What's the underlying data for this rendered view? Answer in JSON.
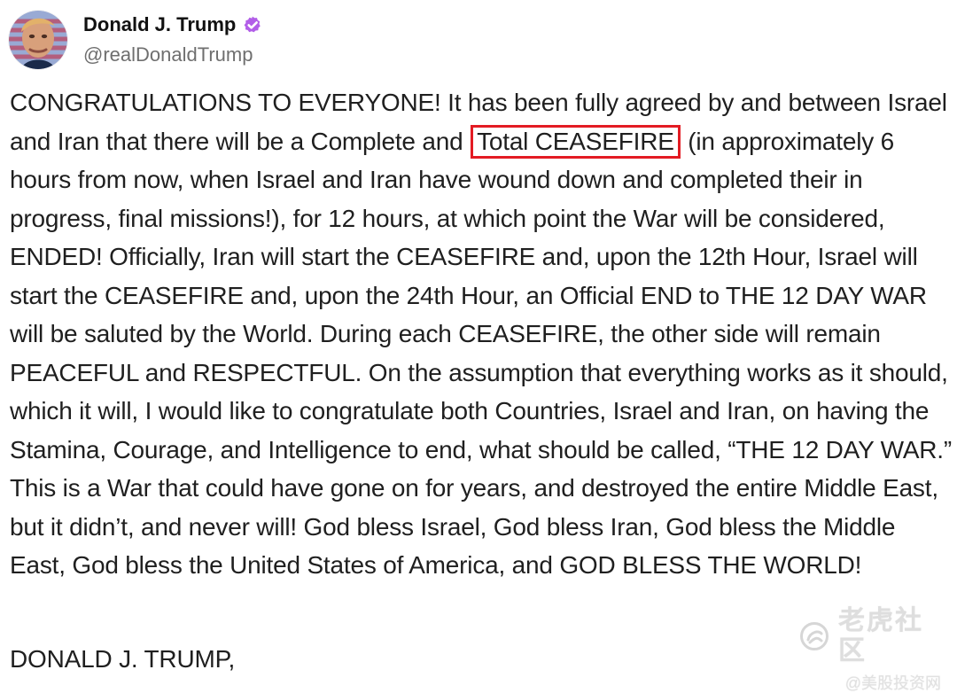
{
  "post": {
    "author": {
      "display_name": "Donald J. Trump",
      "handle": "@realDonaldTrump",
      "verified_icon": "verified-badge-icon",
      "avatar_icon": "avatar"
    },
    "body": {
      "before_highlight": "CONGRATULATIONS TO EVERYONE! It has been fully agreed by and between Israel and Iran that there will be a Complete and ",
      "highlighted_text": "Total CEASEFIRE",
      "after_highlight": " (in approximately 6 hours from now, when Israel and Iran have wound down and completed their in progress, final missions!), for 12 hours, at which point the War will be considered, ENDED! Officially, Iran will start the CEASEFIRE and, upon the 12th Hour, Israel will start the CEASEFIRE and, upon the 24th Hour, an Official END to THE 12 DAY WAR will be saluted by the World. During each CEASEFIRE, the other side will remain PEACEFUL and RESPECTFUL. On the assumption that everything works as it should, which it will, I would like to congratulate both Countries, Israel and Iran, on having the Stamina, Courage, and Intelligence to end, what should be called, “THE 12 DAY WAR.” This is a War that could have gone on for years, and destroyed the entire Middle East, but it didn’t, and never will! God bless Israel, God bless Iran, God bless the Middle East, God bless the United States of America, and GOD BLESS THE WORLD!"
    },
    "signature": "DONALD J. TRUMP,"
  },
  "watermark": {
    "name": "老虎社区",
    "sub": "@美股投资网"
  },
  "colors": {
    "highlight_border": "#e31b23",
    "verified_badge": "#b25ee8"
  }
}
